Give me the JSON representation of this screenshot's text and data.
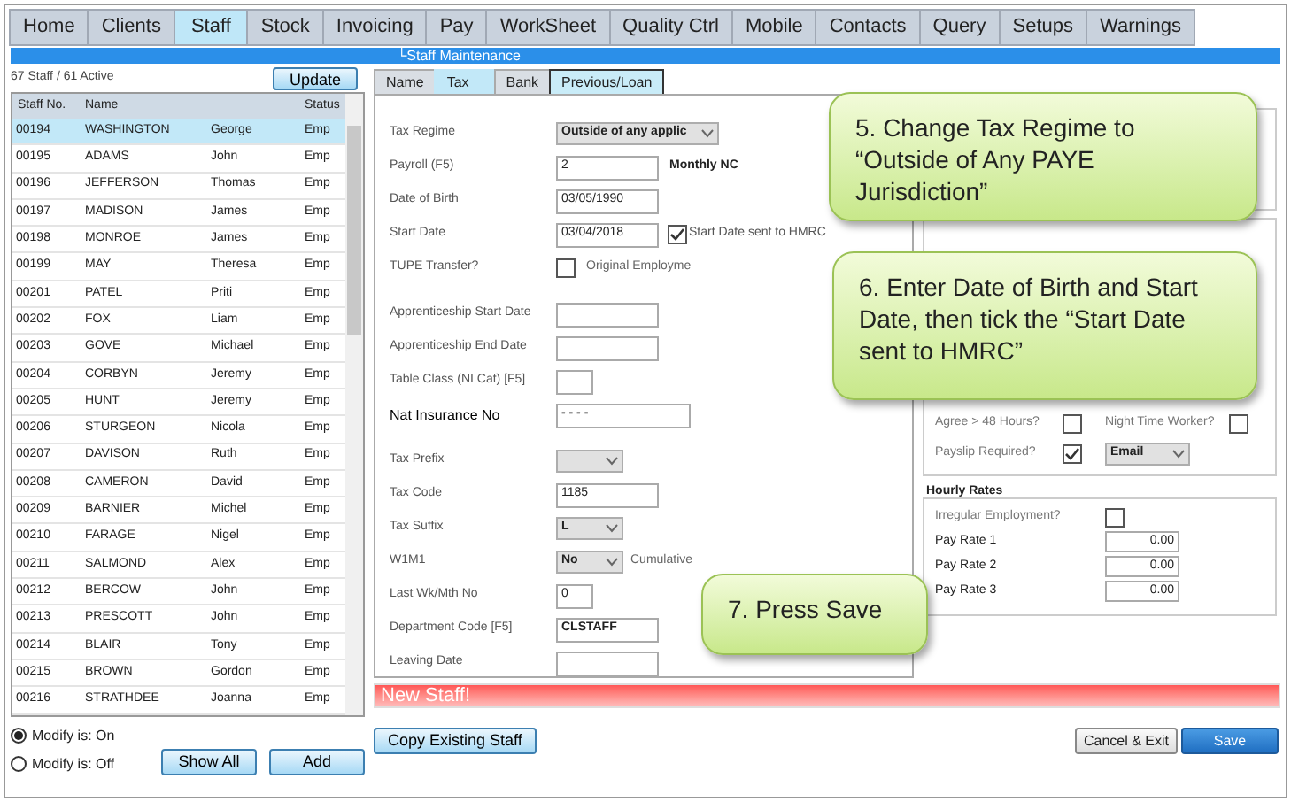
{
  "menu_tabs": [
    {
      "label": "Home",
      "selected": false
    },
    {
      "label": "Clients",
      "selected": false
    },
    {
      "label": "Staff",
      "selected": true
    },
    {
      "label": "Stock",
      "selected": false
    },
    {
      "label": "Invoicing",
      "selected": false
    },
    {
      "label": "Pay",
      "selected": false
    },
    {
      "label": "WorkSheet",
      "selected": false
    },
    {
      "label": "Quality Ctrl",
      "selected": false
    },
    {
      "label": "Mobile",
      "selected": false
    },
    {
      "label": "Contacts",
      "selected": false
    },
    {
      "label": "Query",
      "selected": false
    },
    {
      "label": "Setups",
      "selected": false
    },
    {
      "label": "Warnings",
      "selected": false
    }
  ],
  "breadcrumb": "└Staff Maintenance",
  "staff_list": {
    "summary": "67 Staff / 61 Active",
    "update_button": "Update",
    "columns": [
      "Staff No.",
      "Name",
      "Status"
    ],
    "rows": [
      {
        "no": "00194",
        "surname": "WASHINGTON",
        "first": "George",
        "status": "Emp",
        "selected": true
      },
      {
        "no": "00195",
        "surname": "ADAMS",
        "first": "John",
        "status": "Emp",
        "selected": false
      },
      {
        "no": "00196",
        "surname": "JEFFERSON",
        "first": "Thomas",
        "status": "Emp",
        "selected": false
      },
      {
        "no": "00197",
        "surname": "MADISON",
        "first": "James",
        "status": "Emp",
        "selected": false
      },
      {
        "no": "00198",
        "surname": "MONROE",
        "first": "James",
        "status": "Emp",
        "selected": false
      },
      {
        "no": "00199",
        "surname": "MAY",
        "first": "Theresa",
        "status": "Emp",
        "selected": false
      },
      {
        "no": "00201",
        "surname": "PATEL",
        "first": "Priti",
        "status": "Emp",
        "selected": false
      },
      {
        "no": "00202",
        "surname": "FOX",
        "first": "Liam",
        "status": "Emp",
        "selected": false
      },
      {
        "no": "00203",
        "surname": "GOVE",
        "first": "Michael",
        "status": "Emp",
        "selected": false
      },
      {
        "no": "00204",
        "surname": "CORBYN",
        "first": "Jeremy",
        "status": "Emp",
        "selected": false
      },
      {
        "no": "00205",
        "surname": "HUNT",
        "first": "Jeremy",
        "status": "Emp",
        "selected": false
      },
      {
        "no": "00206",
        "surname": "STURGEON",
        "first": "Nicola",
        "status": "Emp",
        "selected": false
      },
      {
        "no": "00207",
        "surname": "DAVISON",
        "first": "Ruth",
        "status": "Emp",
        "selected": false
      },
      {
        "no": "00208",
        "surname": "CAMERON",
        "first": "David",
        "status": "Emp",
        "selected": false
      },
      {
        "no": "00209",
        "surname": "BARNIER",
        "first": "Michel",
        "status": "Emp",
        "selected": false
      },
      {
        "no": "00210",
        "surname": "FARAGE",
        "first": "Nigel",
        "status": "Emp",
        "selected": false
      },
      {
        "no": "00211",
        "surname": "SALMOND",
        "first": "Alex",
        "status": "Emp",
        "selected": false
      },
      {
        "no": "00212",
        "surname": "BERCOW",
        "first": "John",
        "status": "Emp",
        "selected": false
      },
      {
        "no": "00213",
        "surname": "PRESCOTT",
        "first": "John",
        "status": "Emp",
        "selected": false
      },
      {
        "no": "00214",
        "surname": "BLAIR",
        "first": "Tony",
        "status": "Emp",
        "selected": false
      },
      {
        "no": "00215",
        "surname": "BROWN",
        "first": "Gordon",
        "status": "Emp",
        "selected": false
      },
      {
        "no": "00216",
        "surname": "STRATHDEE",
        "first": "Joanna",
        "status": "Emp",
        "selected": false
      }
    ]
  },
  "modify_options": [
    {
      "label": "Modify is: On",
      "selected": true
    },
    {
      "label": "Modify is: Off",
      "selected": false
    }
  ],
  "left_buttons": [
    "Show All",
    "Add"
  ],
  "form_tabs": [
    {
      "label": "Name",
      "selected": false,
      "highlighted": false
    },
    {
      "label": "Tax",
      "selected": true,
      "highlighted": false
    },
    {
      "label": "Bank",
      "selected": false,
      "highlighted": false
    },
    {
      "label": "Previous/Loan",
      "selected": false,
      "highlighted": true
    }
  ],
  "tax_form": [
    [
      {
        "label": "Tax Regime",
        "kind": "select",
        "value": "Outside of any applic"
      },
      {
        "label": "Payroll (F5)",
        "kind": "text",
        "value": "2",
        "suffix": "Monthly NC"
      },
      {
        "label": "Date of Birth",
        "kind": "text",
        "value": "03/05/1990"
      },
      {
        "label": "Start Date",
        "kind": "text",
        "value": "03/04/2018",
        "check_label": "Start Date sent to HMRC",
        "checked": true
      },
      {
        "label": "TUPE Transfer?",
        "kind": "check",
        "checked": false,
        "after": "Original Employme"
      }
    ],
    [
      {
        "label": "Apprenticeship Start Date",
        "kind": "text"
      },
      {
        "label": "Apprenticeship End Date",
        "kind": "text"
      },
      {
        "label": "Table Class (NI Cat) [F5]",
        "kind": "short"
      },
      {
        "label": "Nat Insurance No",
        "kind": "wide",
        "value": "-  -  -  -",
        "bold": true
      }
    ],
    [
      {
        "label": "Tax Prefix",
        "kind": "select"
      },
      {
        "label": "Tax Code",
        "kind": "text",
        "value": "1185"
      },
      {
        "label": "Tax Suffix",
        "kind": "select",
        "value": "L"
      },
      {
        "label": "W1M1",
        "kind": "select",
        "value": "No",
        "suffix": "Cumulative"
      },
      {
        "label": "Last Wk/Mth No",
        "kind": "short",
        "value": "0"
      },
      {
        "label": "Department Code [F5]",
        "kind": "text",
        "value": "CLSTAFF"
      },
      {
        "label": "Leaving Date",
        "kind": "text"
      }
    ]
  ],
  "working": {
    "agree_48": {
      "label": "Agree > 48 Hours?",
      "checked": false
    },
    "night_worker": {
      "label": "Night Time Worker?",
      "checked": false
    },
    "payslip": {
      "label": "Payslip Required?",
      "checked": true,
      "method": "Email"
    }
  },
  "hourly_rates": {
    "title": "Hourly Rates",
    "irregular": {
      "label": "Irregular Employment?",
      "checked": false
    },
    "rates": [
      {
        "label": "Pay Rate 1",
        "value": "0.00"
      },
      {
        "label": "Pay Rate 2",
        "value": "0.00"
      },
      {
        "label": "Pay Rate 3",
        "value": "0.00"
      }
    ]
  },
  "status_message": "New Staff!",
  "bottom_buttons": {
    "copy": "Copy Existing Staff",
    "cancel": "Cancel & Exit",
    "save": "Save"
  },
  "callouts": [
    "5. Change Tax Regime to “Outside of Any PAYE Jurisdiction”",
    "6. Enter Date of Birth and Start Date, then tick the “Start Date sent to HMRC”",
    "7. Press Save"
  ]
}
